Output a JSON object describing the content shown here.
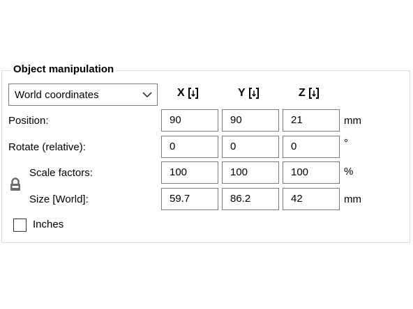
{
  "panel": {
    "title": "Object manipulation",
    "coordinate_system": {
      "selected": "World coordinates",
      "icon": "chevron-down-icon"
    },
    "axes": [
      {
        "label": "X",
        "icon": "drop-to-bed-icon"
      },
      {
        "label": "Y",
        "icon": "drop-to-bed-icon"
      },
      {
        "label": "Z",
        "icon": "drop-to-bed-icon"
      }
    ],
    "rows": {
      "position": {
        "label": "Position:",
        "x": "90",
        "y": "90",
        "z": "21",
        "unit": "mm"
      },
      "rotate": {
        "label": "Rotate (relative):",
        "x": "0",
        "y": "0",
        "z": "0",
        "unit": "°"
      },
      "scale": {
        "label": "Scale factors:",
        "x": "100",
        "y": "100",
        "z": "100",
        "unit": "%"
      },
      "size": {
        "label": "Size [World]:",
        "x": "59.7",
        "y": "86.2",
        "z": "42",
        "unit": "mm"
      }
    },
    "lock_icon": "lock-icon",
    "inches": {
      "label": "Inches",
      "checked": false
    }
  }
}
